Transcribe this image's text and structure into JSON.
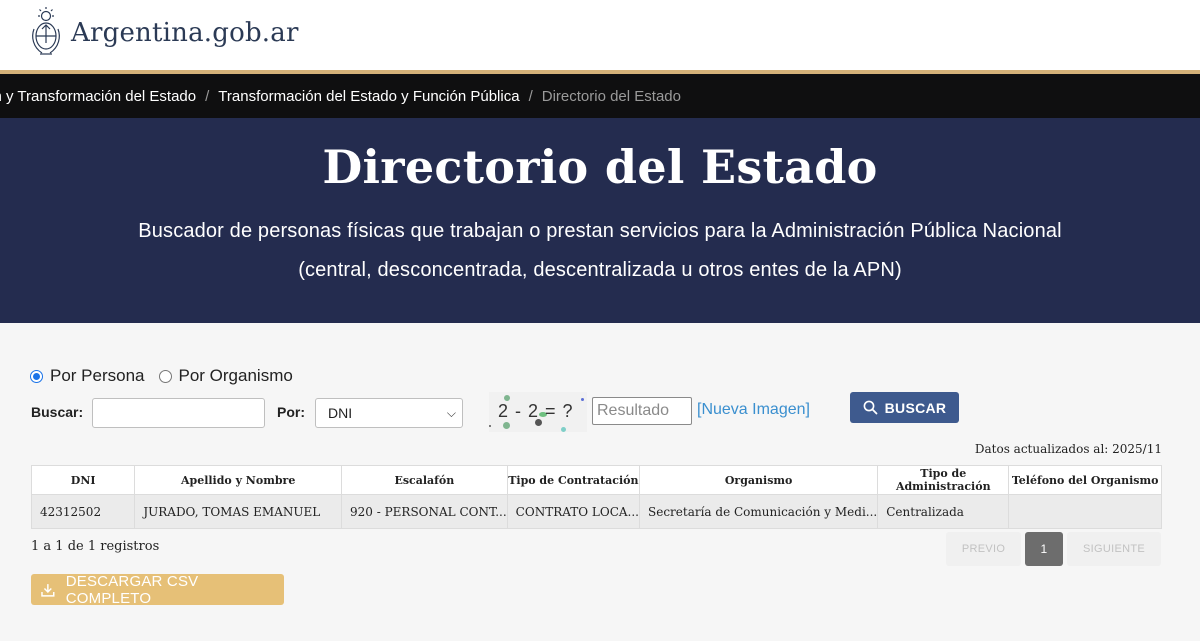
{
  "header": {
    "site_name": "Argentina.gob.ar",
    "logo_icon": "coat-of-arms-icon"
  },
  "breadcrumb": {
    "items": [
      "ación y Transformación del Estado",
      "Transformación del Estado y Función Pública"
    ],
    "current": "Directorio del Estado",
    "separator": "/"
  },
  "hero": {
    "title": "Directorio del Estado",
    "subtitle_line1": "Buscador de personas físicas que trabajan o prestan servicios para la Administración Pública Nacional",
    "subtitle_line2": "(central, desconcentrada, descentralizada u otros entes de la APN)"
  },
  "search": {
    "mode_options": [
      "Por Persona",
      "Por Organismo"
    ],
    "mode_selected": "Por Persona",
    "buscar_label": "Buscar:",
    "buscar_value": "",
    "por_label": "Por:",
    "por_value": "DNI",
    "captcha_text": "2 - 2 = ?",
    "resultado_placeholder": "Resultado",
    "nueva_imagen": "[Nueva Imagen]",
    "buscar_button": "BUSCAR"
  },
  "updated_text": "Datos actualizados al: 2025/11",
  "table": {
    "headers": [
      "DNI",
      "Apellido y Nombre",
      "Escalafón",
      "Tipo de Contratación",
      "Organismo",
      "Tipo de Administración",
      "Teléfono del Organismo"
    ],
    "rows": [
      [
        "42312502",
        "JURADO, TOMAS EMANUEL",
        "920 - PERSONAL CONT...",
        "CONTRATO LOCA...",
        "Secretaría de Comunicación y Medi...",
        "Centralizada",
        ""
      ]
    ]
  },
  "pagination": {
    "records_text": "1 a 1 de 1 registros",
    "prev": "PREVIO",
    "page": "1",
    "next": "SIGUIENTE"
  },
  "csv_button": "DESCARGAR CSV COMPLETO",
  "colors": {
    "hero_bg": "#242c4f",
    "gold": "#d4b178",
    "buscar_btn": "#3e5a8e",
    "csv_btn": "#e6c077",
    "link": "#3a8fcf"
  }
}
